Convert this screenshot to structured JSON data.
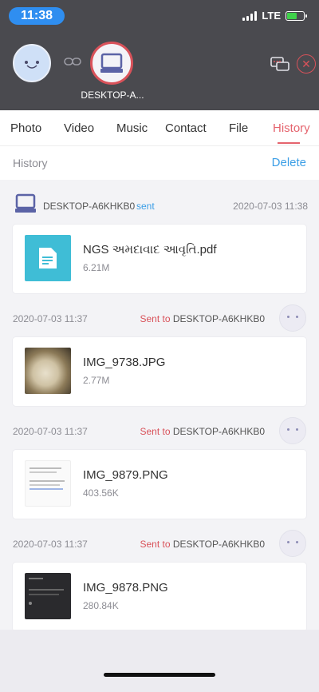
{
  "status_bar": {
    "time": "11:38",
    "network": "LTE"
  },
  "header": {
    "device_label": "DESKTOP-A...",
    "icons": [
      "avatar-face",
      "link-icon",
      "laptop-icon",
      "chat-icon",
      "close-icon"
    ]
  },
  "tabs": [
    {
      "label": "Photo"
    },
    {
      "label": "Video"
    },
    {
      "label": "Music"
    },
    {
      "label": "Contact"
    },
    {
      "label": "File"
    },
    {
      "label": "History",
      "active": true
    }
  ],
  "history_bar": {
    "title": "History",
    "delete_label": "Delete"
  },
  "entries": [
    {
      "header": {
        "device": "DESKTOP-A6KHKB0",
        "status": "sent",
        "timestamp": "2020-07-03 11:38"
      },
      "file": {
        "name": "NGS અમદાવાદ આવૃતિ.pdf",
        "size": "6.21M",
        "type": "pdf"
      }
    },
    {
      "header": {
        "timestamp": "2020-07-03 11:37",
        "prefix": "Sent to ",
        "device": "DESKTOP-A6KHKB0"
      },
      "file": {
        "name": "IMG_9738.JPG",
        "size": "2.77M",
        "type": "photo"
      }
    },
    {
      "header": {
        "timestamp": "2020-07-03 11:37",
        "prefix": "Sent to ",
        "device": "DESKTOP-A6KHKB0"
      },
      "file": {
        "name": "IMG_9879.PNG",
        "size": "403.56K",
        "type": "screenshot-light"
      }
    },
    {
      "header": {
        "timestamp": "2020-07-03 11:37",
        "prefix": "Sent to ",
        "device": "DESKTOP-A6KHKB0"
      },
      "file": {
        "name": "IMG_9878.PNG",
        "size": "280.84K",
        "type": "screenshot-dark"
      }
    }
  ],
  "colors": {
    "accent": "#e5646e",
    "blue": "#3b9ee6",
    "pdf": "#3fbdd6",
    "header_bg": "#4a4a4f"
  }
}
